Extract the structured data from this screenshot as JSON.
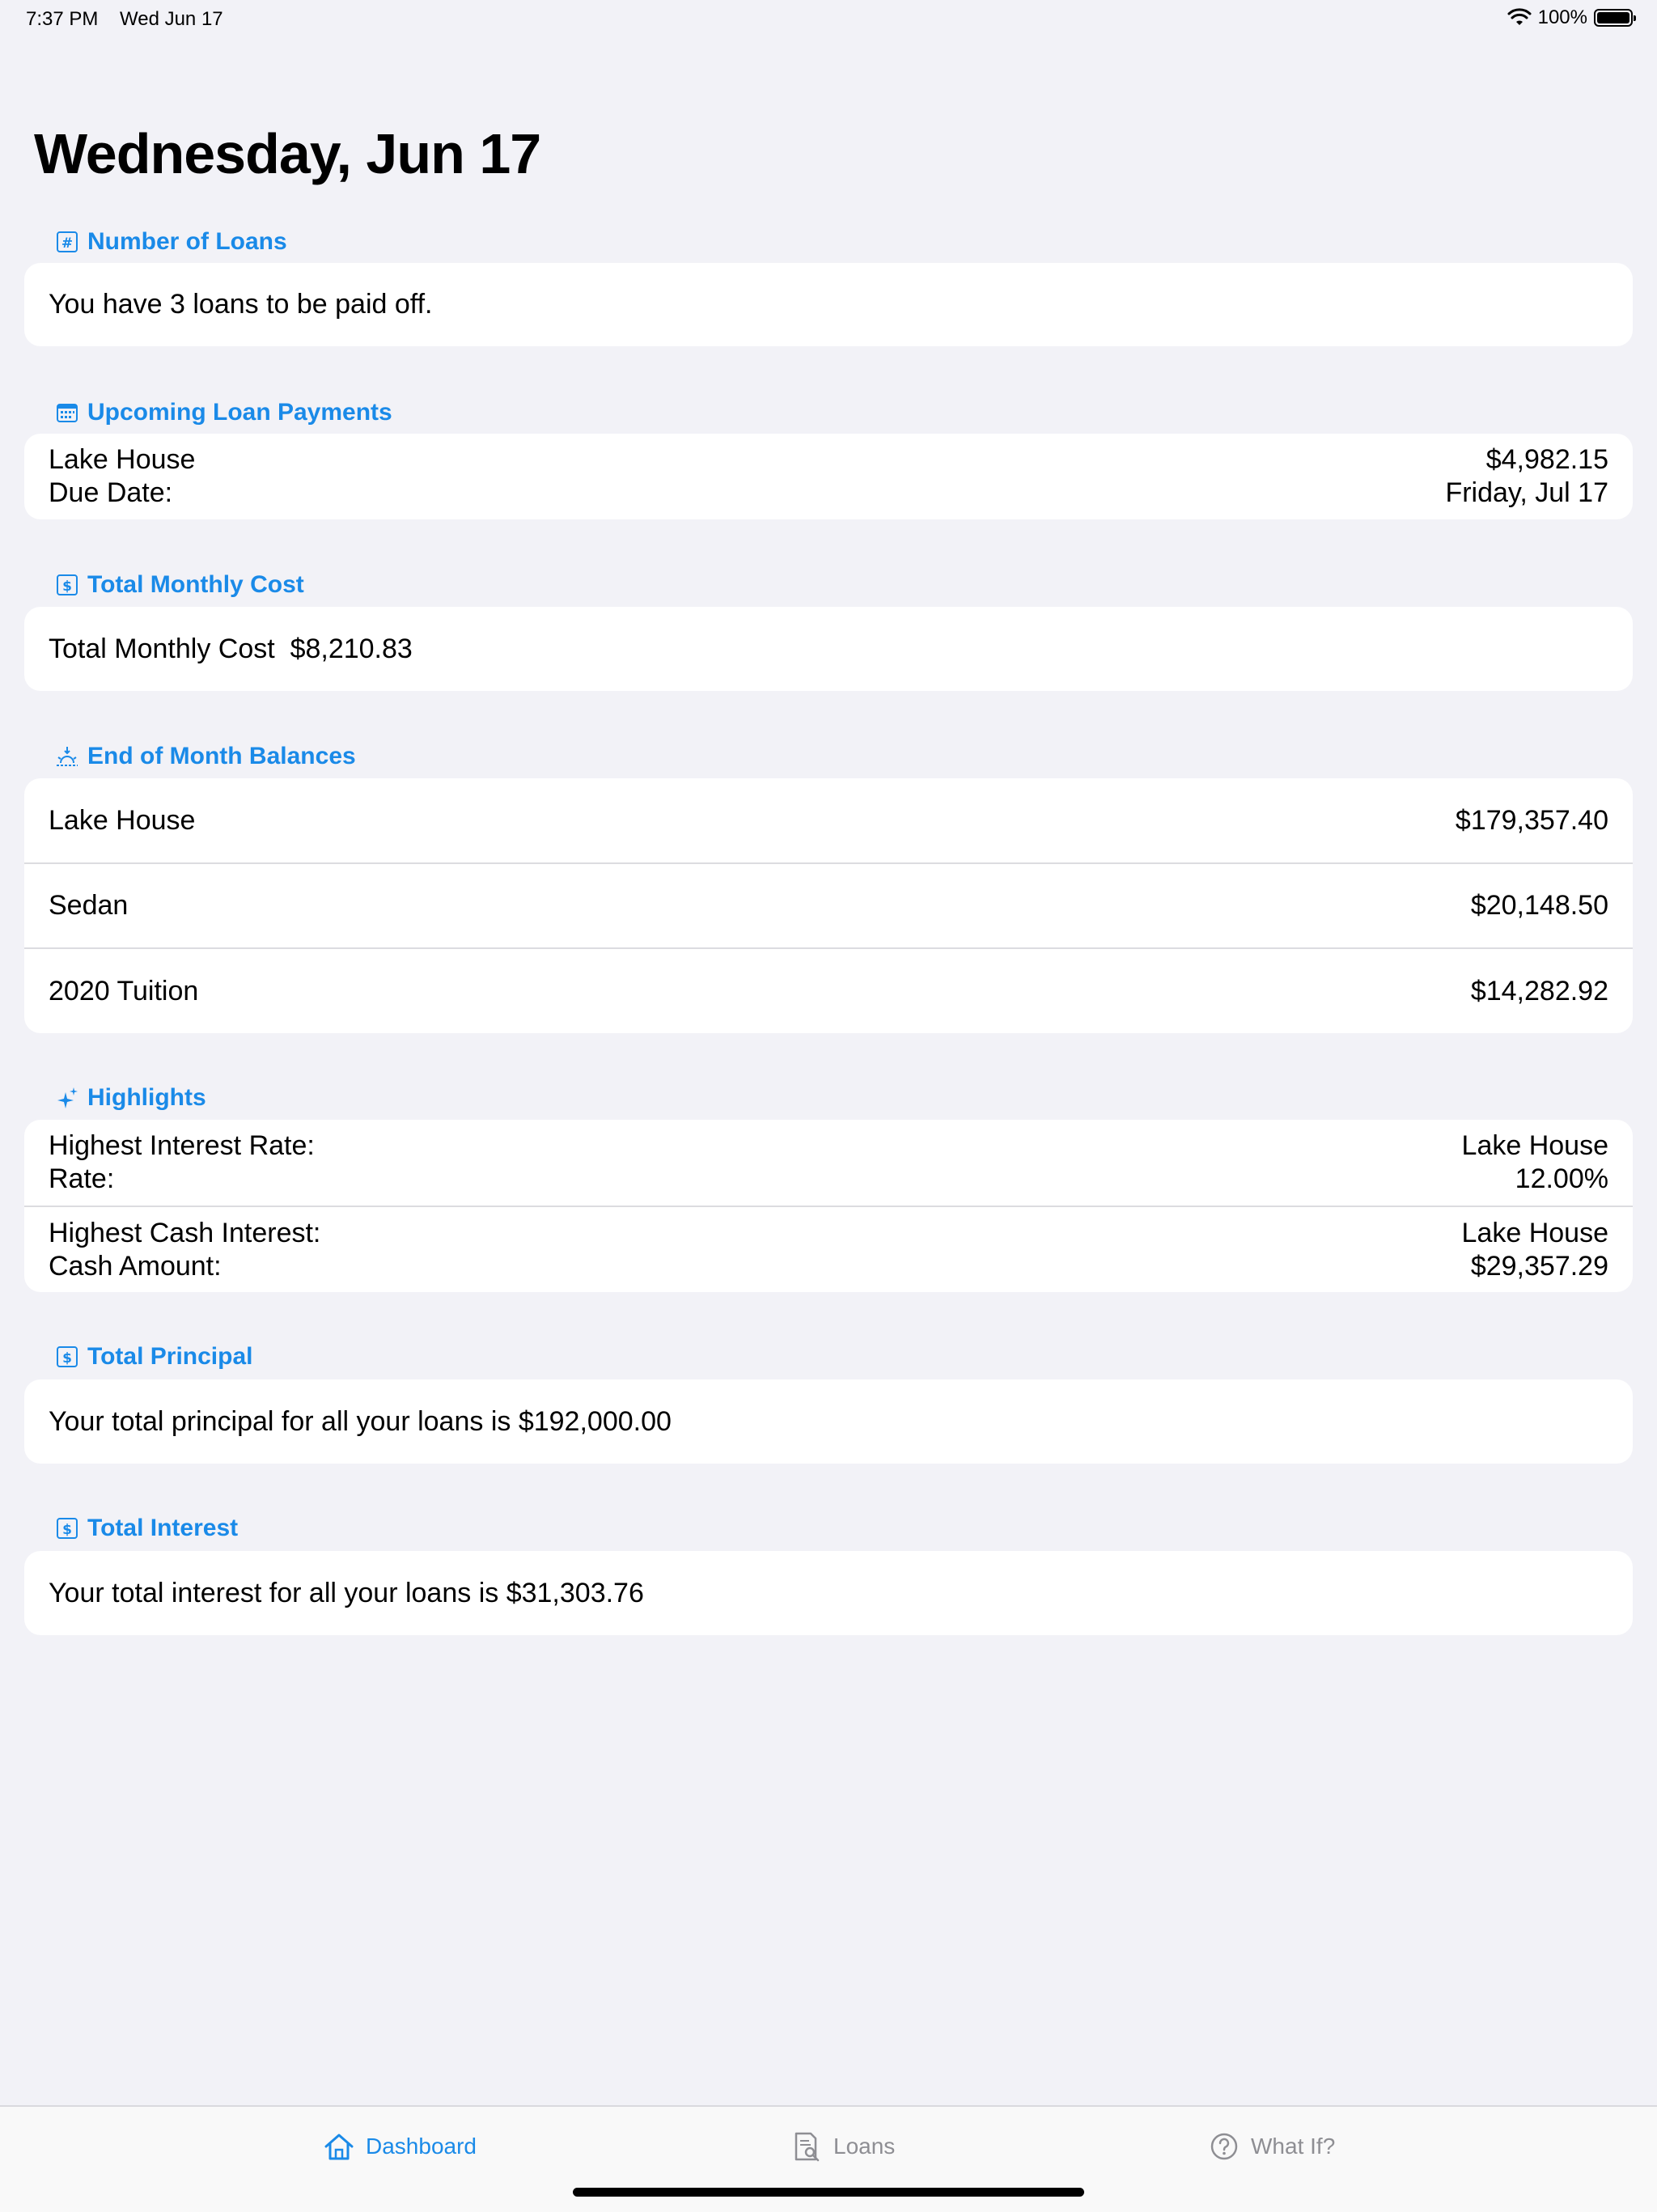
{
  "status_bar": {
    "time": "7:37 PM",
    "date": "Wed Jun 17",
    "battery": "100%",
    "battery_level": 1.0
  },
  "page_title": "Wednesday, Jun 17",
  "sections": {
    "number_of_loans": {
      "title": "Number of Loans",
      "icon": "number-icon",
      "text": "You have 3 loans to be paid off."
    },
    "upcoming_payments": {
      "title": "Upcoming Loan Payments",
      "icon": "calendar-icon",
      "loan_name": "Lake House",
      "amount": "$4,982.15",
      "due_label": "Due Date:",
      "due_date": "Friday, Jul 17"
    },
    "total_monthly_cost": {
      "title": "Total Monthly Cost",
      "icon": "dollar-icon",
      "text": "Total Monthly Cost  $8,210.83"
    },
    "end_of_month": {
      "title": "End of Month Balances",
      "icon": "sunset-icon",
      "rows": [
        {
          "name": "Lake House",
          "value": "$179,357.40"
        },
        {
          "name": "Sedan",
          "value": "$20,148.50"
        },
        {
          "name": "2020 Tuition",
          "value": "$14,282.92"
        }
      ]
    },
    "highlights": {
      "title": "Highlights",
      "icon": "sparkles-icon",
      "rows": [
        {
          "label1": "Highest Interest Rate:",
          "label2": "Rate:",
          "value1": "Lake House",
          "value2": "12.00%"
        },
        {
          "label1": "Highest Cash Interest:",
          "label2": "Cash Amount:",
          "value1": "Lake House",
          "value2": "$29,357.29"
        }
      ]
    },
    "total_principal": {
      "title": "Total Principal",
      "icon": "dollar-icon",
      "text": "Your total principal for all your loans is $192,000.00"
    },
    "total_interest": {
      "title": "Total Interest",
      "icon": "dollar-icon",
      "text": "Your total interest for all your loans is $31,303.76"
    }
  },
  "tab_bar": {
    "tabs": [
      {
        "label": "Dashboard",
        "icon": "house-icon",
        "active": true
      },
      {
        "label": "Loans",
        "icon": "document-search-icon",
        "active": false
      },
      {
        "label": "What If?",
        "icon": "question-circle-icon",
        "active": false
      }
    ]
  },
  "colors": {
    "accent": "#1a8ae8",
    "background": "#f2f2f7",
    "card": "#ffffff",
    "inactive": "#8e8e93"
  }
}
